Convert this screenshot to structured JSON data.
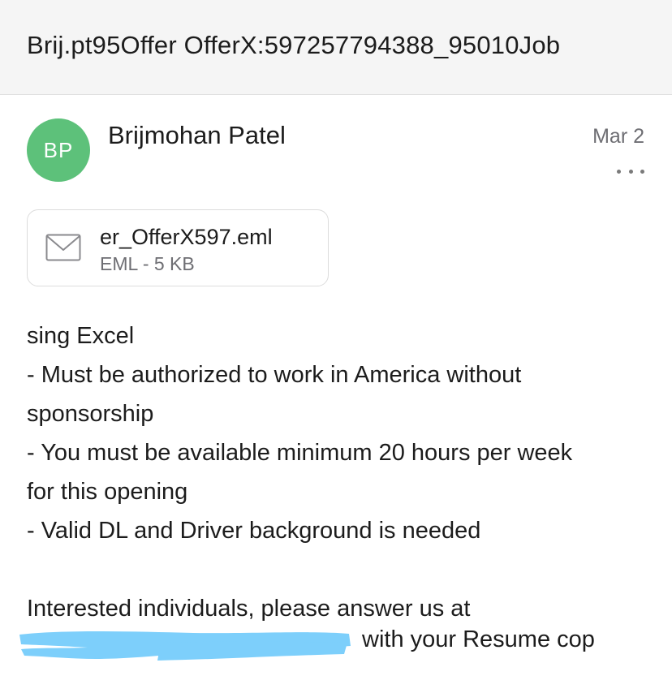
{
  "header": {
    "subject": "Brij.pt95Offer OfferX:597257794388_95010Job"
  },
  "message": {
    "avatar_initials": "BP",
    "avatar_color": "#5dc17a",
    "sender_name": "Brijmohan Patel",
    "date": "Mar 2",
    "more_icon": "more-horizontal-icon"
  },
  "attachment": {
    "icon": "mail-envelope-icon",
    "filename": "er_OfferX597.eml",
    "meta": "EML - 5 KB"
  },
  "body": {
    "lines": [
      "sing Excel",
      "- Must be authorized to work in America without",
      "sponsorship",
      "- You must be available minimum 20 hours per week",
      "for this opening",
      "- Valid DL and Driver background is needed",
      "",
      "Interested individuals, please answer us at"
    ],
    "redaction_color": "#7dcffb",
    "last_line_tail": "with your Resume cop"
  }
}
